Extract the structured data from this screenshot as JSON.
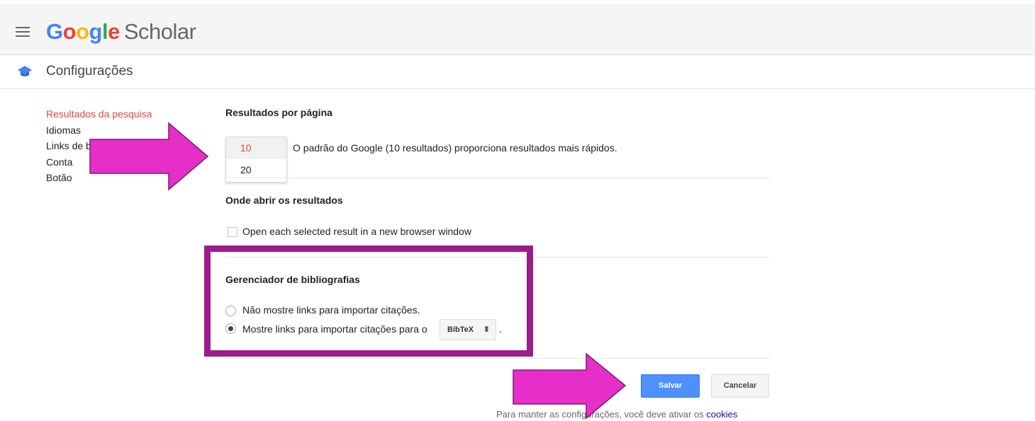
{
  "header": {
    "logo_parts": [
      {
        "char": "G",
        "color": "#4285f4"
      },
      {
        "char": "o",
        "color": "#ea4335"
      },
      {
        "char": "o",
        "color": "#fbbc05"
      },
      {
        "char": "g",
        "color": "#4285f4"
      },
      {
        "char": "l",
        "color": "#34a853"
      },
      {
        "char": "e",
        "color": "#ea4335"
      }
    ],
    "logo_suffix": "Scholar",
    "menu_icon": "hamburger-menu-icon"
  },
  "subheader": {
    "icon": "scholar-cap-icon",
    "title": "Configurações"
  },
  "sidebar": {
    "items": [
      {
        "label": "Resultados da pesquisa",
        "active": true
      },
      {
        "label": "Idiomas",
        "active": false
      },
      {
        "label": "Links de b",
        "active": false
      },
      {
        "label": "Conta",
        "active": false
      },
      {
        "label": "Botão",
        "active": false
      }
    ]
  },
  "results_per_page": {
    "title": "Resultados por página",
    "options": [
      "10",
      "20"
    ],
    "selected": "10",
    "description": "O padrão do Google (10 resultados) proporciona resultados mais rápidos."
  },
  "open_results": {
    "title": "Onde abrir os resultados",
    "checkbox_label": "Open each selected result in a new browser window",
    "checked": false
  },
  "bibliography": {
    "title": "Gerenciador de bibliografias",
    "option_none": "Não mostre links para importar citações.",
    "option_show": "Mostre links para importar citações para o",
    "selected_format": "BibTeX",
    "period": "."
  },
  "actions": {
    "save_label": "Salvar",
    "cancel_label": "Cancelar"
  },
  "footer": {
    "note": "Para manter as configurações, você deve ativar os",
    "link": "cookies"
  },
  "colors": {
    "accent_red": "#dd4b39",
    "save_blue": "#4d90fe",
    "annotation_magenta": "#e62ec9",
    "annotation_purple": "#9b1d8a"
  }
}
